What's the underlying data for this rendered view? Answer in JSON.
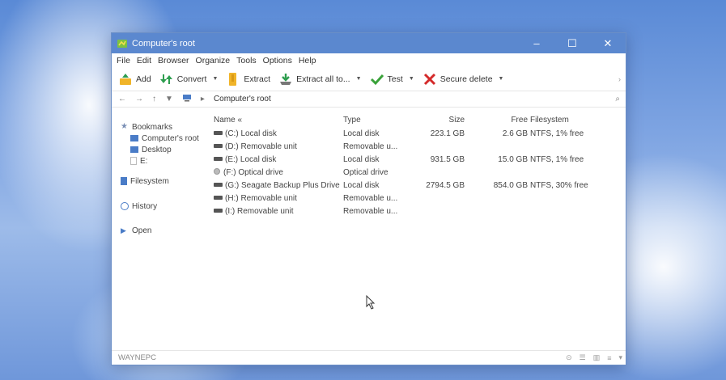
{
  "window": {
    "title": "Computer's root",
    "controls": {
      "minimize": "–",
      "maximize": "☐",
      "close": "✕"
    }
  },
  "menu": [
    "File",
    "Edit",
    "Browser",
    "Organize",
    "Tools",
    "Options",
    "Help"
  ],
  "toolbar": {
    "add": "Add",
    "convert": "Convert",
    "extract": "Extract",
    "extract_all": "Extract all to...",
    "test": "Test",
    "secure_delete": "Secure delete"
  },
  "address": {
    "path": "Computer's root"
  },
  "sidebar": {
    "bookmarks": "Bookmarks",
    "bookmark_items": [
      "Computer's root",
      "Desktop",
      "E:"
    ],
    "filesystem": "Filesystem",
    "history": "History",
    "open": "Open"
  },
  "columns": {
    "name": "Name «",
    "type": "Type",
    "size": "Size",
    "free": "Free",
    "filesystem": "Filesystem"
  },
  "rows": [
    {
      "icon": "drive",
      "name": "(C:) Local disk",
      "type": "Local disk",
      "size": "223.1 GB",
      "free": "2.6 GB",
      "fs": "NTFS, 1% free"
    },
    {
      "icon": "drive",
      "name": "(D:) Removable unit",
      "type": "Removable u...",
      "size": "",
      "free": "",
      "fs": ""
    },
    {
      "icon": "drive",
      "name": "(E:) Local disk",
      "type": "Local disk",
      "size": "931.5 GB",
      "free": "15.0 GB",
      "fs": "NTFS, 1% free"
    },
    {
      "icon": "optical",
      "name": "(F:) Optical drive",
      "type": "Optical drive",
      "size": "",
      "free": "",
      "fs": ""
    },
    {
      "icon": "drive",
      "name": "(G:) Seagate Backup Plus Drive",
      "type": "Local disk",
      "size": "2794.5 GB",
      "free": "854.0 GB",
      "fs": "NTFS, 30% free"
    },
    {
      "icon": "drive",
      "name": "(H:) Removable unit",
      "type": "Removable u...",
      "size": "",
      "free": "",
      "fs": ""
    },
    {
      "icon": "drive",
      "name": "(I:) Removable unit",
      "type": "Removable u...",
      "size": "",
      "free": "",
      "fs": ""
    }
  ],
  "status": {
    "machine": "WAYNEPC"
  },
  "colors": {
    "titlebar": "#5b88cf",
    "convert_green": "#2e9e4f",
    "test_green": "#3aa23a",
    "delete_red": "#d42a2a",
    "folder_yellow": "#f0b429"
  }
}
